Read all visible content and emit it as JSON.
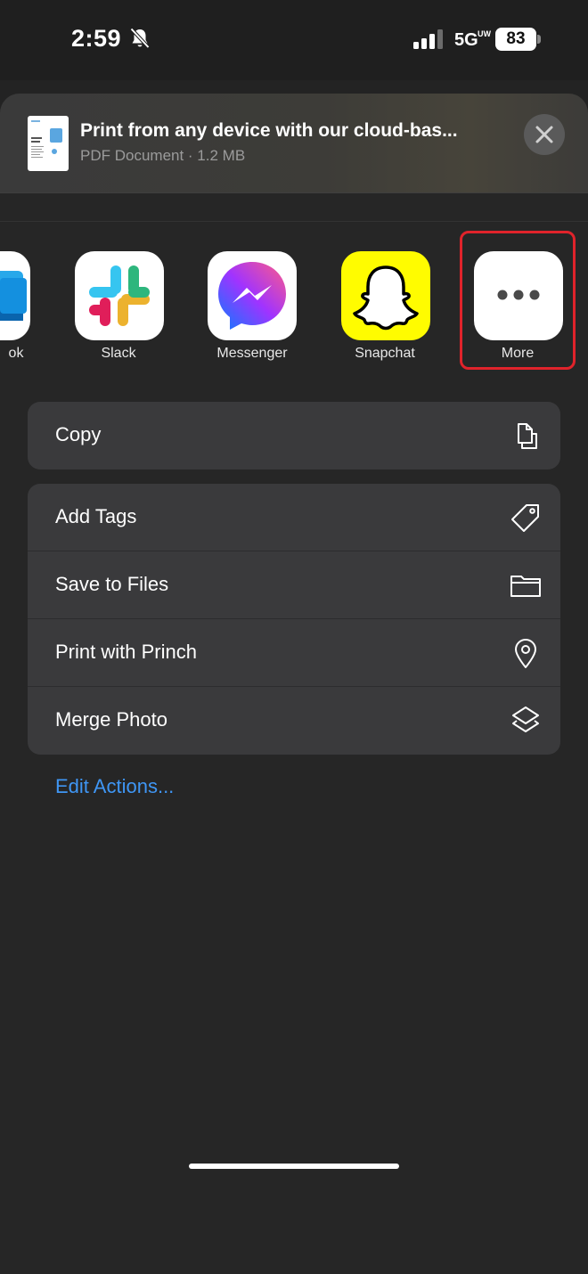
{
  "status_bar": {
    "time": "2:59",
    "network": "5G",
    "network_sub": "UW",
    "battery": "83"
  },
  "share_sheet": {
    "document": {
      "title": "Print from any device with our cloud-bas...",
      "subtitle": "PDF Document · 1.2 MB"
    },
    "apps": [
      {
        "label": "ok",
        "icon": "outlook-app-icon"
      },
      {
        "label": "Slack",
        "icon": "slack-app-icon"
      },
      {
        "label": "Messenger",
        "icon": "messenger-app-icon"
      },
      {
        "label": "Snapchat",
        "icon": "snapchat-app-icon"
      },
      {
        "label": "More",
        "icon": "more-ellipsis-icon"
      }
    ],
    "copy_group": [
      {
        "label": "Copy",
        "icon": "copy-icon"
      }
    ],
    "actions_group": [
      {
        "label": "Add Tags",
        "icon": "tag-icon"
      },
      {
        "label": "Save to Files",
        "icon": "folder-icon"
      },
      {
        "label": "Print with Princh",
        "icon": "location-pin-icon"
      },
      {
        "label": "Merge Photo",
        "icon": "layers-icon"
      }
    ],
    "edit_actions": "Edit Actions..."
  },
  "colors": {
    "highlight": "#e0232b",
    "link": "#3f96f4",
    "snapchat_yellow": "#fffc00"
  }
}
